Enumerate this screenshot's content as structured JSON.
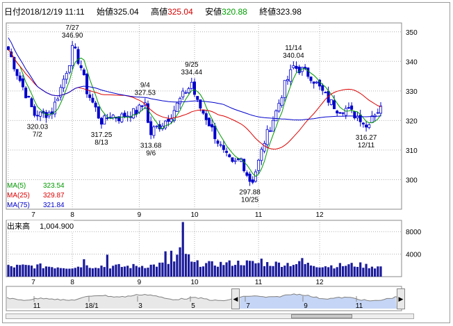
{
  "header": {
    "date_label": "日付",
    "date_value": "2018/12/19 11:11",
    "open_label": "始値",
    "open_value": "325.04",
    "high_label": "高値",
    "high_value": "325.04",
    "low_label": "安値",
    "low_value": "320.88",
    "close_label": "終値",
    "close_value": "323.98"
  },
  "colors": {
    "up": "#0000cc",
    "down": "#0000cc",
    "ma5": "#009900",
    "ma25": "#dd0000",
    "ma75": "#0000cc",
    "grid": "#b0b0b0",
    "volume": "#1a1a9a",
    "nav_fill": "#c5d5f5"
  },
  "ma_legend": [
    {
      "label": "MA(5)",
      "value": "323.54",
      "color": "#009900"
    },
    {
      "label": "MA(25)",
      "value": "329.87",
      "color": "#dd0000"
    },
    {
      "label": "MA(75)",
      "value": "321.84",
      "color": "#0000cc"
    }
  ],
  "volume_label": "出来高",
  "volume_value": "1,004.900",
  "chart_data": {
    "type": "candlestick",
    "price_axis": {
      "ticks": [
        300,
        310,
        320,
        330,
        340,
        350
      ],
      "ylim": [
        290,
        353
      ]
    },
    "volume_axis": {
      "ticks": [
        4000,
        8000
      ],
      "ylim": [
        0,
        10000
      ]
    },
    "month_labels": [
      "7",
      "8",
      "9",
      "10",
      "11",
      "12"
    ],
    "month_start_index": [
      0,
      22,
      45,
      64,
      86,
      107
    ],
    "annotations": [
      {
        "index": 10,
        "value": 320.03,
        "text": "320.03",
        "date": "7/2",
        "pos": "below"
      },
      {
        "index": 22,
        "value": 346.9,
        "text": "346.90",
        "date": "7/27",
        "pos": "above"
      },
      {
        "index": 32,
        "value": 317.25,
        "text": "317.25",
        "date": "8/13",
        "pos": "below"
      },
      {
        "index": 47,
        "value": 327.53,
        "text": "327.53",
        "date": "9/4",
        "pos": "above"
      },
      {
        "index": 49,
        "value": 313.68,
        "text": "313.68",
        "date": "9/6",
        "pos": "below"
      },
      {
        "index": 63,
        "value": 334.44,
        "text": "334.44",
        "date": "9/25",
        "pos": "above"
      },
      {
        "index": 83,
        "value": 297.88,
        "text": "297.88",
        "date": "10/25",
        "pos": "below"
      },
      {
        "index": 98,
        "value": 340.04,
        "text": "340.04",
        "date": "11/14",
        "pos": "above"
      },
      {
        "index": 123,
        "value": 316.27,
        "text": "316.27",
        "date": "12/11",
        "pos": "below"
      }
    ],
    "close_anchors": [
      [
        0,
        344
      ],
      [
        3,
        336
      ],
      [
        6,
        329
      ],
      [
        9,
        322
      ],
      [
        12,
        322
      ],
      [
        15,
        323
      ],
      [
        18,
        331
      ],
      [
        21,
        340
      ],
      [
        23,
        343
      ],
      [
        25,
        338
      ],
      [
        27,
        330
      ],
      [
        30,
        324
      ],
      [
        32,
        319
      ],
      [
        35,
        322
      ],
      [
        38,
        321
      ],
      [
        41,
        322
      ],
      [
        44,
        323
      ],
      [
        46,
        325
      ],
      [
        48,
        319
      ],
      [
        50,
        317
      ],
      [
        53,
        319
      ],
      [
        56,
        322
      ],
      [
        59,
        327
      ],
      [
        61,
        330
      ],
      [
        63,
        332
      ],
      [
        65,
        326
      ],
      [
        68,
        321
      ],
      [
        71,
        315
      ],
      [
        74,
        309
      ],
      [
        77,
        305
      ],
      [
        80,
        307
      ],
      [
        82,
        302
      ],
      [
        84,
        300
      ],
      [
        86,
        306
      ],
      [
        88,
        313
      ],
      [
        90,
        318
      ],
      [
        92,
        323
      ],
      [
        95,
        332
      ],
      [
        98,
        338
      ],
      [
        101,
        337
      ],
      [
        104,
        335
      ],
      [
        107,
        331
      ],
      [
        110,
        327
      ],
      [
        113,
        324
      ],
      [
        116,
        324
      ],
      [
        119,
        322
      ],
      [
        121,
        321
      ],
      [
        123,
        318
      ],
      [
        125,
        322
      ],
      [
        128,
        324
      ]
    ],
    "volume_anchors": [
      [
        0,
        1800
      ],
      [
        10,
        1900
      ],
      [
        20,
        1700
      ],
      [
        30,
        1900
      ],
      [
        40,
        1800
      ],
      [
        50,
        2000
      ],
      [
        57,
        2600
      ],
      [
        60,
        5200
      ],
      [
        63,
        2400
      ],
      [
        70,
        2200
      ],
      [
        80,
        2500
      ],
      [
        90,
        2300
      ],
      [
        100,
        2300
      ],
      [
        110,
        1900
      ],
      [
        120,
        2100
      ],
      [
        128,
        1700
      ]
    ],
    "volume_peaks": [
      [
        60,
        9700
      ],
      [
        54,
        4500
      ],
      [
        56,
        4600
      ],
      [
        26,
        3100
      ],
      [
        87,
        3200
      ],
      [
        101,
        3300
      ],
      [
        34,
        3900
      ]
    ]
  },
  "navigator": {
    "labels": [
      "11",
      "18/1",
      "3",
      "5",
      "7",
      "9",
      "11"
    ],
    "left_arrow": "◀",
    "right_arrow": "▶"
  }
}
